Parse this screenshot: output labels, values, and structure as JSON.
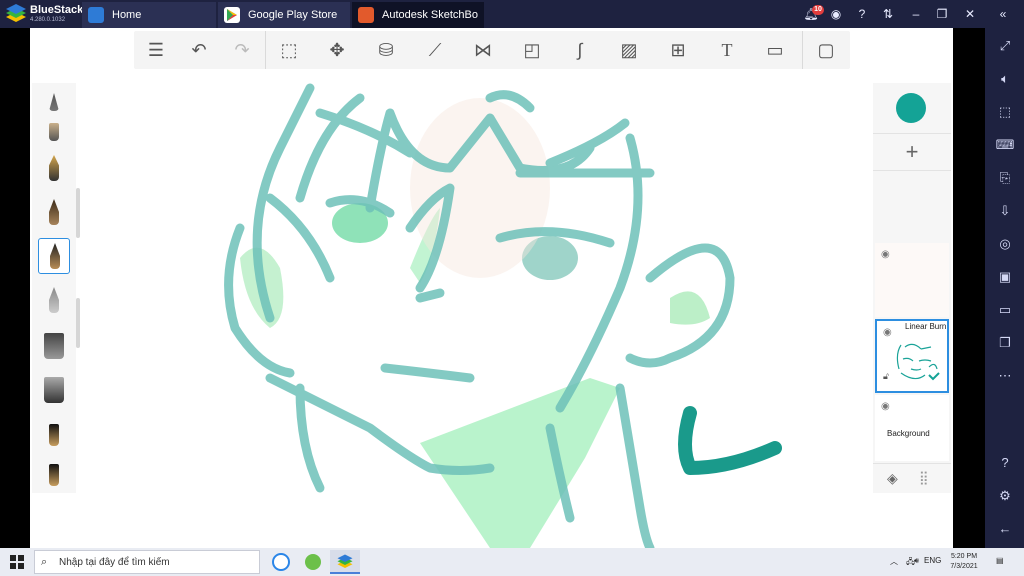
{
  "bluestacks": {
    "name": "BlueStacks",
    "version": "4.280.0.1032",
    "tabs": [
      {
        "label": "Home"
      },
      {
        "label": "Google Play Store"
      },
      {
        "label": "Autodesk SketchBook"
      }
    ],
    "notification_count": "10",
    "window_controls": [
      "bell-icon",
      "account-icon",
      "help-icon",
      "transfer-icon",
      "minimize-icon",
      "restore-icon",
      "close-icon",
      "collapse-icon"
    ],
    "sidebar_tools": [
      "fullscreen-icon",
      "volume-icon",
      "pointer-icon",
      "keyboard-icon",
      "install-apk-icon",
      "media-import-icon",
      "screenshot-icon",
      "record-icon",
      "folder-icon",
      "multi-instance-icon",
      "more-icon",
      "help-icon",
      "settings-icon",
      "back-icon"
    ]
  },
  "sketchbook": {
    "toolbar": [
      "layers-list-icon",
      "undo-icon",
      "redo-icon",
      "selection-icon",
      "transform-icon",
      "fill-icon",
      "ruler-icon",
      "symmetry-icon",
      "shape-icon",
      "curve-icon",
      "image-icon",
      "perspective-icon",
      "text-icon",
      "video-icon",
      "fullscreen-icon"
    ],
    "brushes": [
      "brush-settings",
      "brush-1",
      "brush-pen",
      "brush-ink",
      "brush-marker",
      "brush-pencil",
      "brush-chisel-1",
      "brush-chisel-2",
      "brush-felt-1",
      "brush-felt-2"
    ],
    "selected_brush_index": 4,
    "current_color": "#14a396",
    "layers": [
      {
        "name": "",
        "blend": ""
      },
      {
        "name": "Linear Burn",
        "selected": true
      },
      {
        "name": "Background"
      }
    ]
  },
  "taskbar": {
    "search_placeholder": "Nhập tại đây để tìm kiếm",
    "apps": [
      "zalo-icon",
      "bluestacks-settings-icon",
      "bluestacks-icon"
    ],
    "language": "ENG",
    "time": "5:20 PM",
    "date": "7/3/2021"
  }
}
